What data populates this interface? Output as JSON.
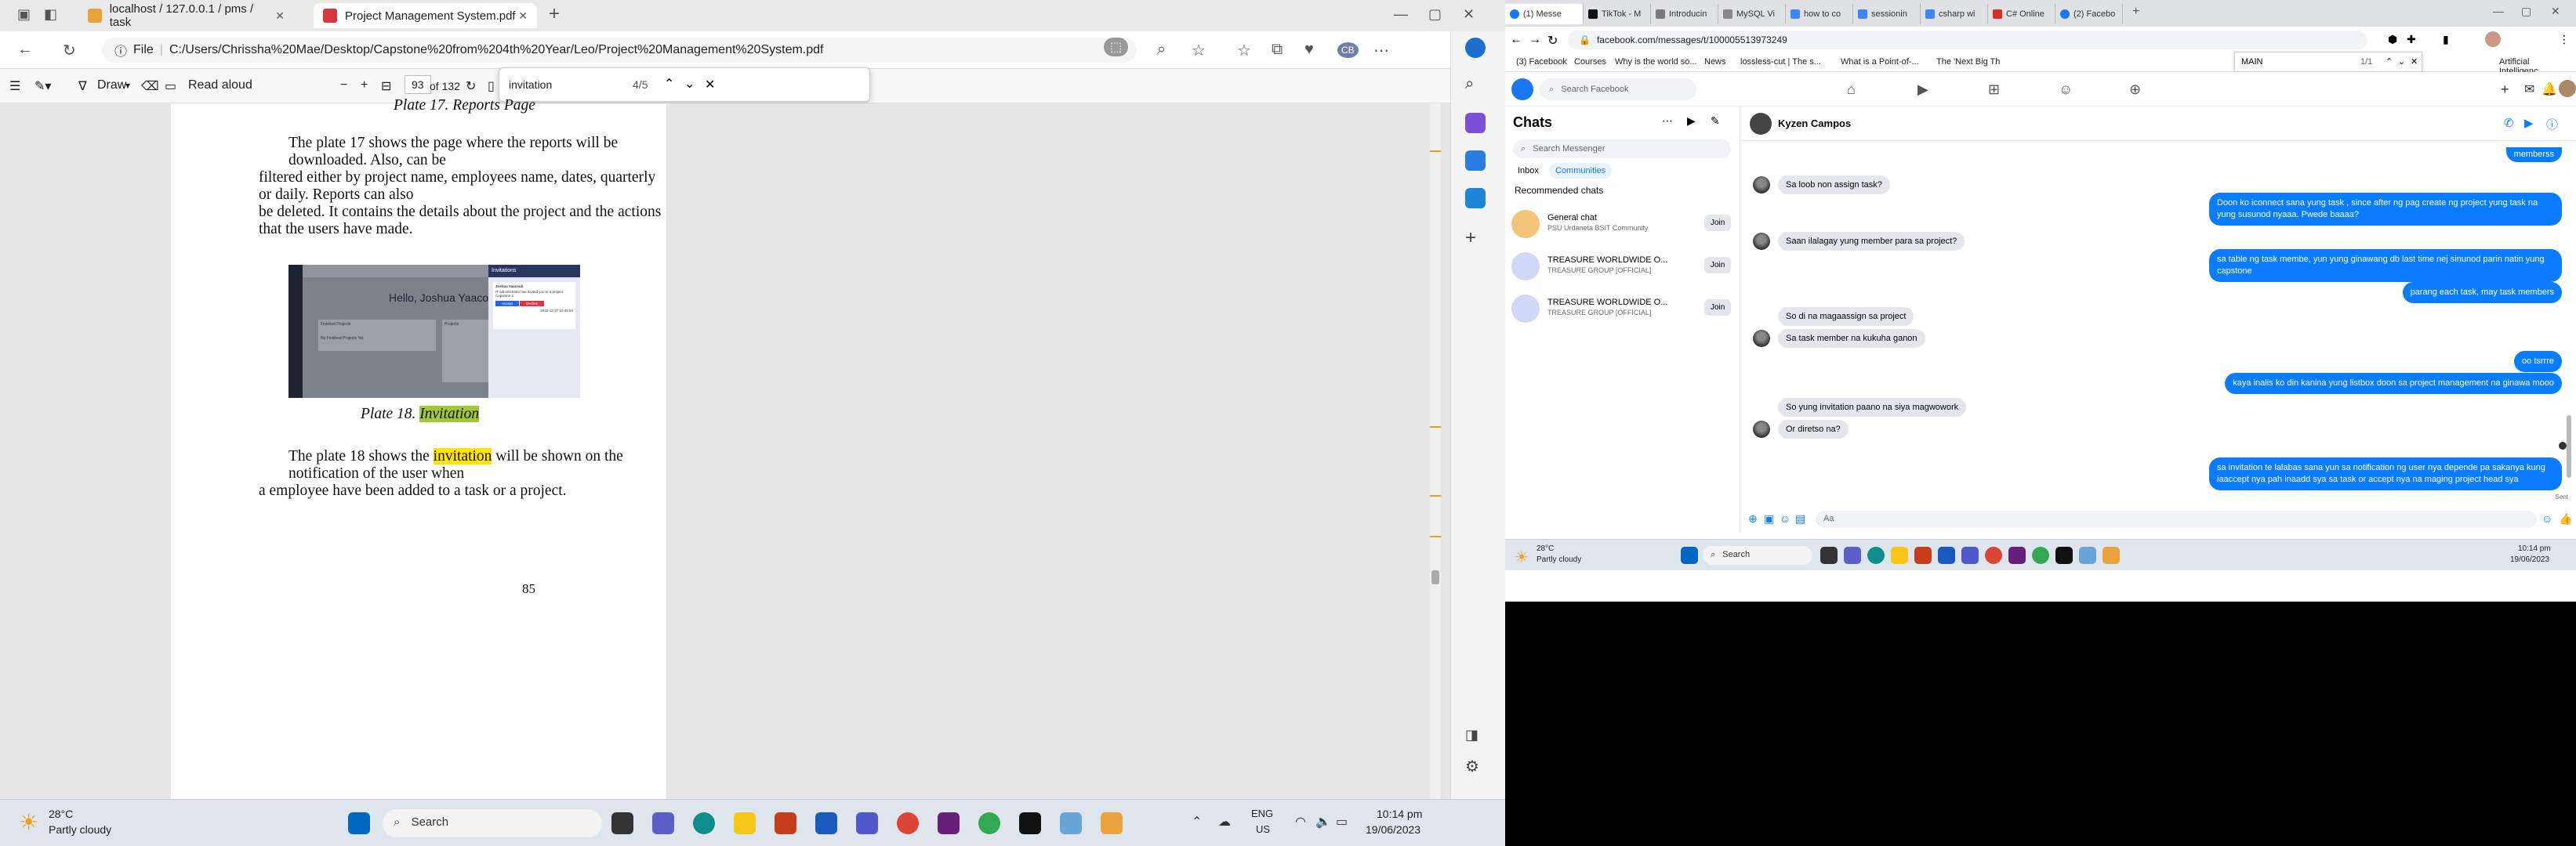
{
  "left": {
    "tabs": [
      {
        "title": "localhost / 127.0.0.1 / pms / task"
      },
      {
        "title": "Project Management System.pdf"
      }
    ],
    "address": "C:/Users/Chrissha%20Mae/Desktop/Capstone%20from%204th%20Year/Leo/Project%20Management%20System.pdf",
    "address_scheme": "File",
    "toolbar": {
      "draw": "Draw",
      "read_aloud": "Read aloud",
      "page_current": "93",
      "page_total": "of 132"
    },
    "find": {
      "query": "invitation",
      "count": "4/5"
    },
    "pdf": {
      "prev_caption": "Plate 17. Reports Page",
      "para1": [
        "The plate 17 shows the page where the reports will be downloaded. Also, can be",
        "filtered either by project name, employees name, dates, quarterly or daily. Reports can also",
        "be deleted. It contains the details about the project and the actions that the users have made."
      ],
      "caption_prefix": "Plate 18.",
      "caption_word": "Invitation",
      "para2_a": "The plate 18 shows the",
      "para2_hl": "invitation",
      "para2_b": "will be shown on the notification of the user when",
      "para2_line2": "a employee have been added to a task or a project.",
      "page_number": "85",
      "screenshot": {
        "hello": "Hello, Joshua Yaacou",
        "invitations_title": "Invitations",
        "inviter": "Joshua Yaacoub",
        "invite_text": "IT administrator has invited you to a project: Capstone 2",
        "accept": "Accept",
        "decline": "Decline",
        "invite_time": "2022-12-27 10:45:54",
        "finished_projects": "Finished Projects",
        "no_finished": "No Finished Projects Yet",
        "projects": "Projects"
      }
    },
    "taskbar": {
      "temp": "28°C",
      "weather": "Partly cloudy",
      "search": "Search",
      "lang1": "ENG",
      "lang2": "US",
      "time": "10:14 pm",
      "date": "19/06/2023"
    }
  },
  "right": {
    "tabs": [
      "(1) Messe",
      "TikTok - M",
      "Introducin",
      "MySQL Vi",
      "how to co",
      "sessionin",
      "csharp wi",
      "C# Online",
      "(2) Facebo"
    ],
    "address": "facebook.com/messages/t/100005513973249",
    "bookmarks": [
      "(3) Facebook",
      "Courses",
      "Why is the world so...",
      "News",
      "lossless-cut | The s...",
      "What is a Point-of-...",
      "The 'Next Big Th",
      "Artificial Intelligenc..."
    ],
    "find": {
      "query": "MAIN",
      "count": "1/1"
    },
    "fb": {
      "search_placeholder": "Search Facebook",
      "chats_title": "Chats",
      "search_messenger": "Search Messenger",
      "filter_inbox": "Inbox",
      "filter_communities": "Communities",
      "recommended": "Recommended chats",
      "rec": [
        {
          "name": "General chat",
          "sub": "PSU Urdaneta BSIT Community",
          "join": "Join"
        },
        {
          "name": "TREASURE WORLDWIDE O...",
          "sub": "TREASURE GROUP [OFFICIAL]",
          "join": "Join"
        },
        {
          "name": "TREASURE WORLDWIDE O...",
          "sub": "TREASURE GROUP [OFFICIAL]",
          "join": "Join"
        }
      ],
      "contact": "Kyzen Campos",
      "messages_in": [
        "Sa loob non assign task?",
        "Saan ilalagay yung member para sa project?",
        "So di na magaassign sa project",
        "Sa task member na kukuha ganon",
        "So yung invitation paano na siya magwowork",
        "Or diretso na?"
      ],
      "messages_out": [
        "memberss",
        "Doon ko iconnect sana yung task , since after ng pag create ng project yung task na yung susunod nyaaa. Pwede baaaa?",
        "sa table ng task membe, yun yung ginawang db last time nej sinunod parin natin yung capstone",
        "parang each task, may task members",
        "oo tsrrre",
        "kaya inalis ko din kanina yung listbox doon sa project management na ginawa mooo",
        "sa invitation te lalabas sana yun sa notification ng user nya depende pa sakanya kung iaaccept nya pah inaadd sya sa task or accept nya na maging project head sya"
      ],
      "sent": "Sent",
      "composer_placeholder": "Aa"
    },
    "taskbar": {
      "temp": "28°C",
      "weather": "Partly cloudy",
      "search": "Search",
      "time": "10:14 pm",
      "date": "19/06/2023"
    }
  }
}
